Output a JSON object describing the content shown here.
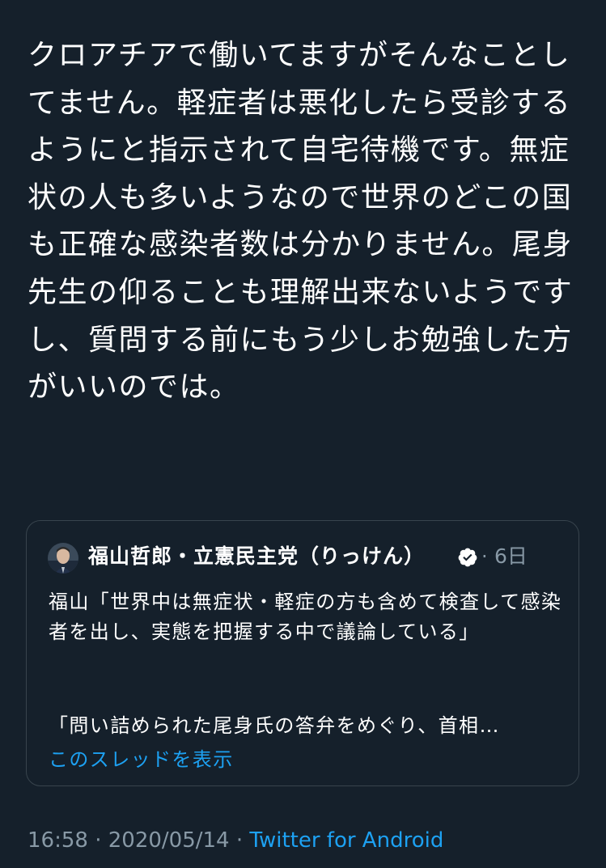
{
  "tweet": {
    "text": "クロアチアで働いてますがそんなことしてません。軽症者は悪化したら受診するようにと指示されて自宅待機です。無症状の人も多いようなので世界のどこの国も正確な感染者数は分かりません。尾身先生の仰ることも理解出来ないようですし、質問する前にもう少しお勉強した方がいいのでは。"
  },
  "quoted_tweet": {
    "author_name": "福山哲郎・立憲民主党（りっけん）",
    "verified_icon": "verified-badge-icon",
    "separator": "·",
    "date": "6日",
    "body": "福山「世界中は無症状・軽症の方も含めて検査して感染者を出し、実態を把握する中で議論している」",
    "snippet": "「問い詰められた尾身氏の答弁をめぐり、首相…",
    "show_thread_label": "このスレッドを表示"
  },
  "meta": {
    "time": "16:58",
    "sep1": "·",
    "date": "2020/05/14",
    "sep2": "·",
    "source": "Twitter for Android"
  },
  "colors": {
    "background": "#15202b",
    "text": "#ffffff",
    "secondary": "#8899a6",
    "link": "#1da1f2",
    "border": "#38444d"
  }
}
